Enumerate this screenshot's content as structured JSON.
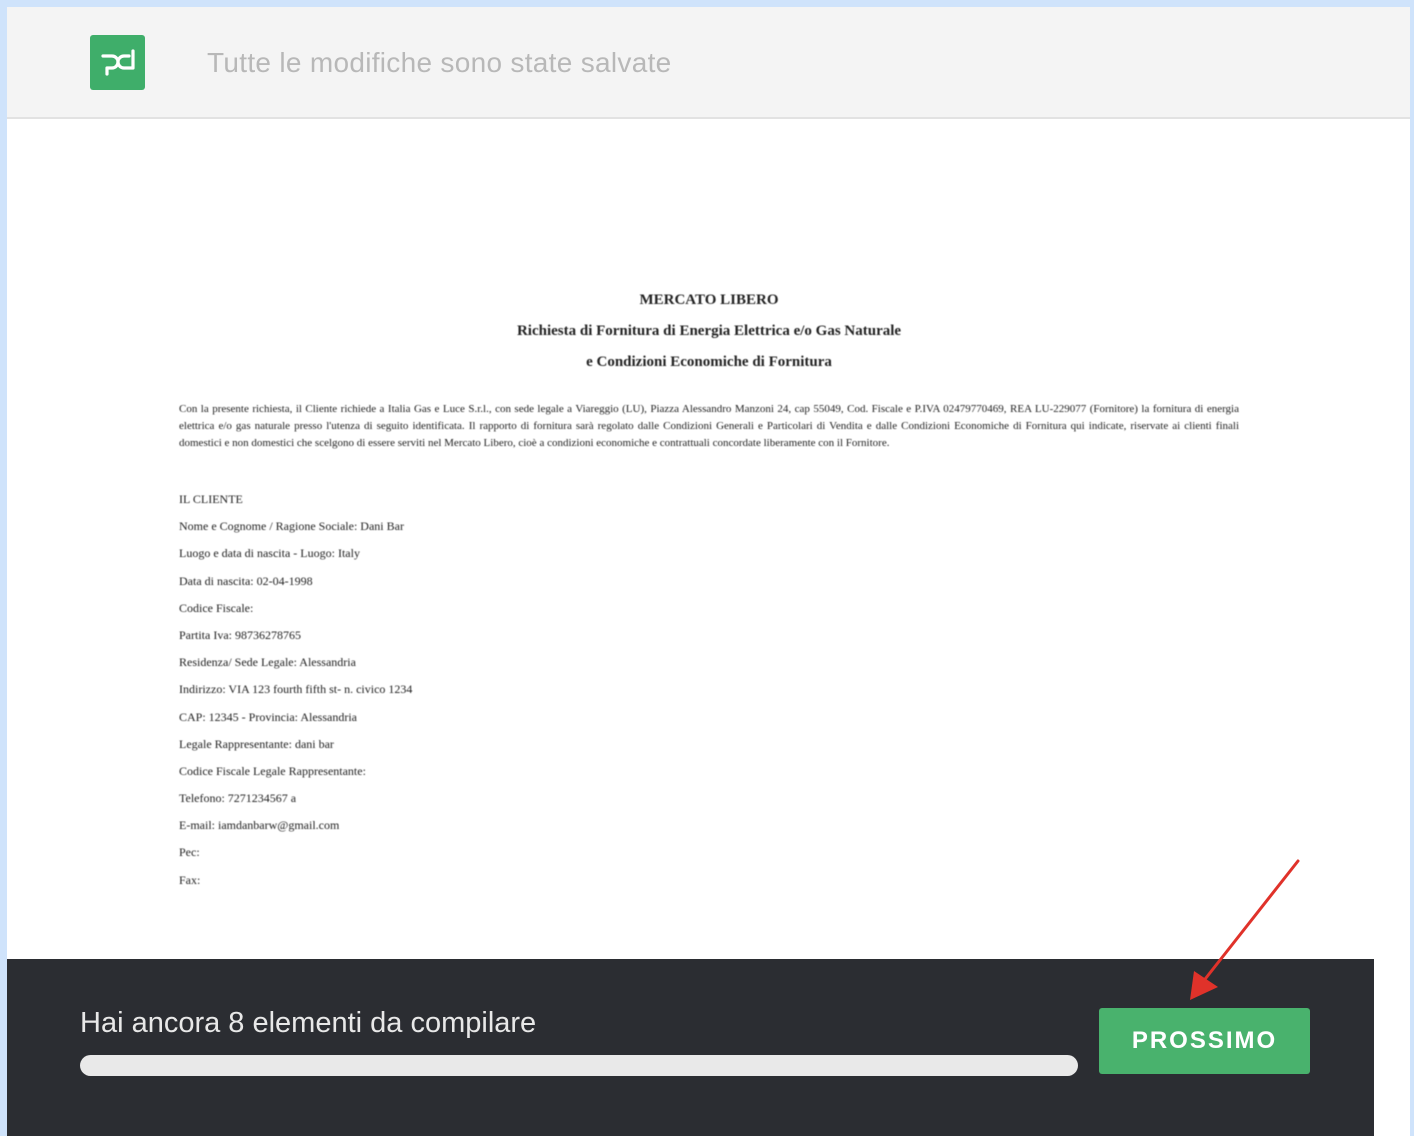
{
  "header": {
    "logo_icon": "pandadoc-logo-icon",
    "save_status": "Tutte le modifiche sono state salvate"
  },
  "document": {
    "title_lines": [
      "MERCATO LIBERO",
      "Richiesta di Fornitura di Energia Elettrica e/o Gas Naturale",
      "e Condizioni Economiche di Fornitura"
    ],
    "intro": "Con la presente richiesta, il Cliente richiede a Italia Gas e Luce S.r.l., con sede legale a Viareggio (LU), Piazza Alessandro Manzoni 24, cap 55049, Cod. Fiscale e P.IVA 02479770469, REA LU-229077 (Fornitore) la fornitura di energia elettrica e/o gas naturale presso l'utenza di seguito identificata. Il rapporto di fornitura sarà regolato dalle Condizioni Generali e Particolari di Vendita e dalle Condizioni Economiche di Fornitura qui indicate, riservate ai clienti finali domestici e non domestici che scelgono di essere serviti nel Mercato Libero, cioè a condizioni economiche e contrattuali concordate liberamente con il Fornitore.",
    "section_title": "IL CLIENTE",
    "fields": [
      "Nome e Cognome / Ragione Sociale: Dani Bar",
      "Luogo e data di nascita - Luogo: Italy",
      "Data di nascita: 02-04-1998",
      "Codice Fiscale:",
      "Partita Iva: 98736278765",
      "Residenza/ Sede Legale: Alessandria",
      "Indirizzo: VIA 123 fourth fifth st- n. civico 1234",
      "CAP: 12345 - Provincia: Alessandria",
      "Legale Rappresentante: dani bar",
      "Codice Fiscale Legale Rappresentante:",
      "Telefono: 7271234567 a",
      "E-mail: iamdanbarw@gmail.com",
      "Pec:",
      "Fax:"
    ]
  },
  "footer": {
    "remaining_text": "Hai ancora 8 elementi da compilare",
    "progress_percent": 0,
    "next_button": "PROSSIMO"
  },
  "colors": {
    "brand_green": "#49b26d",
    "footer_bg": "#2b2d32",
    "annotation_arrow": "#e0322a"
  }
}
